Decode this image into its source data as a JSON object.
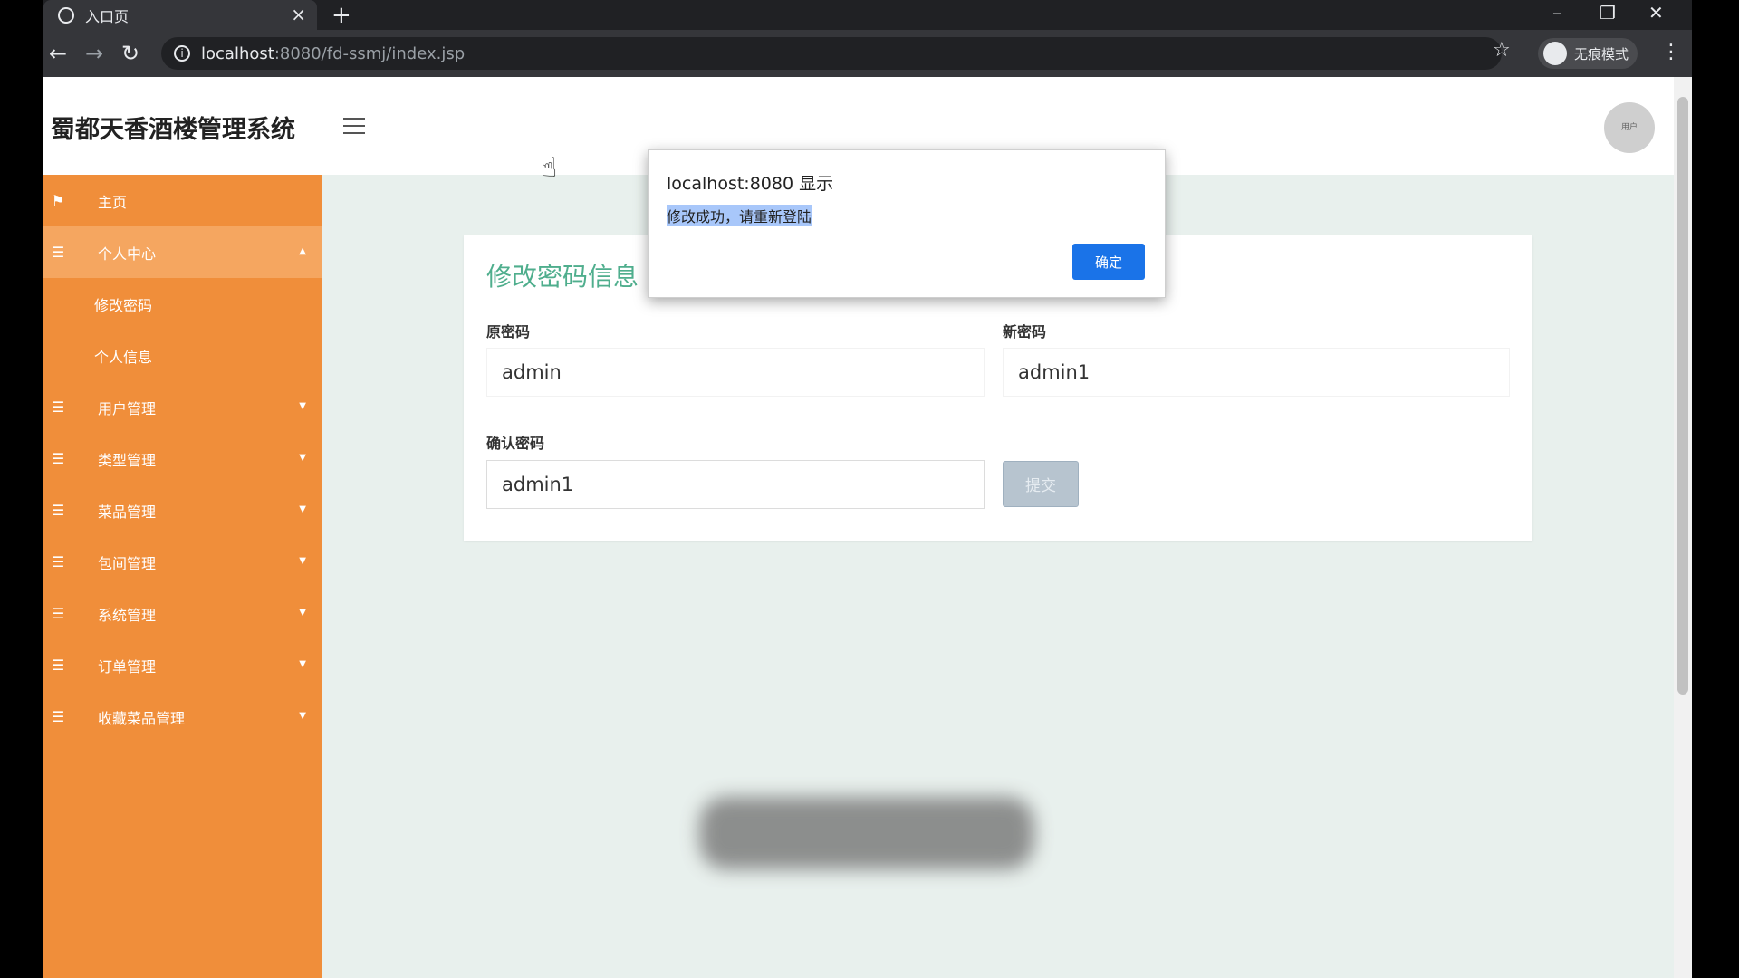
{
  "browser": {
    "tab_title": "入口页",
    "tab_close": "×",
    "new_tab": "+",
    "url_host": "localhost",
    "url_path": ":8080/fd-ssmj/index.jsp",
    "incognito_label": "无痕模式",
    "window_controls": [
      "–",
      "❐",
      "✕"
    ]
  },
  "header": {
    "brand": "蜀都天香酒楼管理系统",
    "avatar_text": "用户"
  },
  "sidebar": {
    "items": [
      {
        "icon": "flag-icon",
        "label": "主页",
        "active": false,
        "caret": false
      },
      {
        "icon": "grid-icon",
        "label": "个人中心",
        "active": true,
        "caret": true
      },
      {
        "icon": "grid-icon",
        "label": "用户管理",
        "active": false,
        "caret": true
      },
      {
        "icon": "grid-icon",
        "label": "类型管理",
        "active": false,
        "caret": true
      },
      {
        "icon": "grid-icon",
        "label": "菜品管理",
        "active": false,
        "caret": true
      },
      {
        "icon": "grid-icon",
        "label": "包间管理",
        "active": false,
        "caret": true
      },
      {
        "icon": "grid-icon",
        "label": "系统管理",
        "active": false,
        "caret": true
      },
      {
        "icon": "grid-icon",
        "label": "订单管理",
        "active": false,
        "caret": true
      },
      {
        "icon": "grid-icon",
        "label": "收藏菜品管理",
        "active": false,
        "caret": true
      }
    ],
    "subitems": [
      "修改密码",
      "个人信息"
    ]
  },
  "form": {
    "title": "修改密码信息",
    "old_label": "原密码",
    "old_value": "admin",
    "new_label": "新密码",
    "new_value": "admin1",
    "confirm_label": "确认密码",
    "confirm_value": "admin1",
    "submit_label": "提交"
  },
  "dialog": {
    "title": "localhost:8080 显示",
    "message": "修改成功，请重新登陆",
    "ok_label": "确定"
  },
  "colors": {
    "sidebar": "#f08e3a",
    "sidebar_active": "#f5a660",
    "title_green": "#4fae8d",
    "dialog_button": "#1a73e8"
  }
}
